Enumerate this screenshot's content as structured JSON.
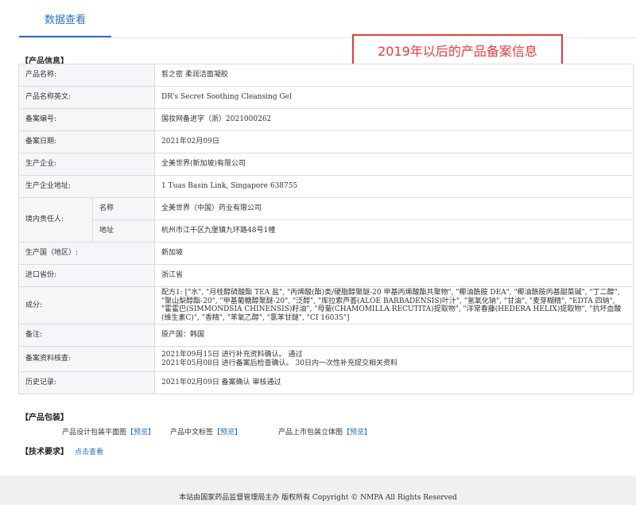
{
  "tab": {
    "label": "数据查看"
  },
  "annotation": {
    "text": "2019年以后的产品备案信息"
  },
  "product_info": {
    "title": "【产品信息】",
    "rows": [
      {
        "label": "产品名称:",
        "value": "皙之密 柔润洁面凝胶"
      },
      {
        "label": "产品名称英文:",
        "value": "DR's Secret Soothing Cleansing Gel"
      },
      {
        "label": "备案编号:",
        "value": "国妆网备进字（浙）2021000262"
      },
      {
        "label": "备案日期:",
        "value": "2021年02月09日"
      },
      {
        "label": "生产企业:",
        "value": "全美世界(新加坡)有限公司"
      },
      {
        "label": "生产企业地址:",
        "value": "1 Tuas Basin Link, Singapore 638755"
      }
    ],
    "responsible": {
      "label": "境内责任人:",
      "name_label": "名称",
      "name_value": "全美世界（中国）药业有限公司",
      "address_label": "地址",
      "address_value": "杭州市江干区九堡镇九环路48号1幢"
    },
    "rows2": [
      {
        "label": "生产国（地区）:",
        "value": "新加坡"
      },
      {
        "label": "进口省份:",
        "value": "浙江省"
      }
    ],
    "ingredients": {
      "label": "成分:",
      "value": "配方1: [\"水\", \"月桂醇硫酸酯 TEA 盐\", \"丙烯酸(酯)类/硬脂醇聚醚-20 甲基丙烯酸酯共聚物\", \"椰油酰胺 DEA\", \"椰油酰胺丙基甜菜碱\", \"丁二醇\", \"聚山梨醇酯-20\", \"甲基葡糖醇聚醚-20\", \"泛醇\", \"库拉索芦荟(ALOE BARBADENSIS)叶汁\", \"氢氧化钠\", \"甘油\", \"麦芽糊精\", \"EDTA 四钠\", \"霍霍巴(SIMMONDSIA CHINENSIS)籽油\", \"母菊(CHAMOMILLA RECUTITA)提取物\", \"洋常春藤(HEDERA HELIX)提取物\", \"抗坏血酸(维生素C)\", \"香精\", \"苯氧乙醇\", \"氯苯甘醚\", \"CI 16035\"]"
    },
    "remark": {
      "label": "备注:",
      "value": "原产国：韩国"
    },
    "review": {
      "label": "备案资料核查:",
      "line1": "2021年09月15日 进行补充资料确认。 通过",
      "line2": "2021年05月08日 进行备案后检查确认。 30日内一次性补充提交相关资料"
    },
    "history": {
      "label": "历史记录:",
      "value": "2021年02月09日 备案确认 审核通过"
    }
  },
  "packaging": {
    "title": "【产品包装】",
    "items": [
      {
        "label": "产品设计包装平面图",
        "link": "【预览】"
      },
      {
        "label": "产品中文标签",
        "link": "【预览】"
      },
      {
        "label": "产品上市包装立体图",
        "link": "【预览】"
      }
    ]
  },
  "tech": {
    "title": "【技术要求】",
    "link": "点击查看"
  },
  "footer": {
    "text": "本站由国家药品监督管理局主办 版权所有 Copyright © NMPA All Rights Reserved"
  }
}
